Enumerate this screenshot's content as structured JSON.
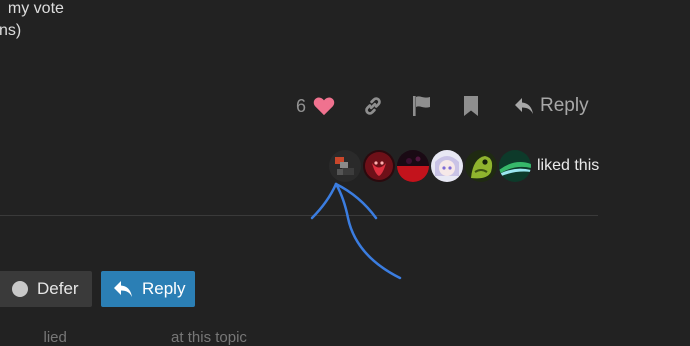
{
  "post": {
    "line1": "  my vote",
    "line2": "ns)"
  },
  "actions": {
    "like_count": "6",
    "reply_label": "Reply"
  },
  "likers": {
    "avatars": [
      "avatar-1",
      "avatar-2",
      "avatar-3",
      "avatar-4",
      "avatar-5",
      "avatar-6"
    ],
    "liked_text": "liked this"
  },
  "footer": {
    "defer_label": "Defer",
    "reply_label": "Reply",
    "partial_text": "         lied                         at this topic"
  },
  "colors": {
    "heart": "#f0728f",
    "reply_button": "#2b7fb5",
    "annotation": "#3b7de0"
  }
}
